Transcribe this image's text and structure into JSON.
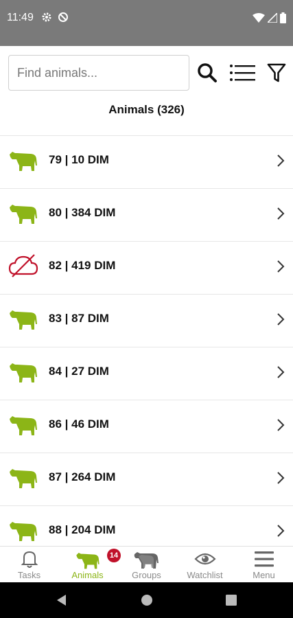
{
  "status_bar": {
    "time": "11:49"
  },
  "search": {
    "placeholder": "Find animals..."
  },
  "list": {
    "title": "Animals (326)",
    "items": [
      {
        "label": "79 | 10 DIM",
        "icon": "cow-icon"
      },
      {
        "label": "80 | 384 DIM",
        "icon": "cow-icon"
      },
      {
        "label": "82 | 419 DIM",
        "icon": "cloud-off-icon"
      },
      {
        "label": "83 | 87 DIM",
        "icon": "cow-icon"
      },
      {
        "label": "84 | 27 DIM",
        "icon": "cow-icon"
      },
      {
        "label": "86 | 46 DIM",
        "icon": "cow-icon"
      },
      {
        "label": "87 | 264 DIM",
        "icon": "cow-icon"
      },
      {
        "label": "88 | 204 DIM",
        "icon": "cow-icon"
      }
    ]
  },
  "bottom_nav": {
    "tasks": "Tasks",
    "animals": "Animals",
    "animals_badge": "14",
    "groups": "Groups",
    "watchlist": "Watchlist",
    "menu": "Menu"
  },
  "colors": {
    "accent": "#8cb517",
    "alert": "#c0112a",
    "status_bar": "#7a7a7a"
  }
}
